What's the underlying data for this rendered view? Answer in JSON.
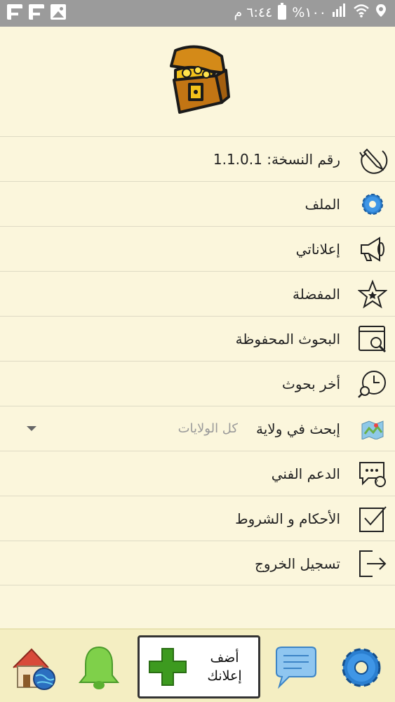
{
  "status_bar": {
    "time": "٦:٤٤ م",
    "battery": "%١٠٠",
    "icons": [
      "flipboard-icon",
      "flipboard-icon",
      "image-icon",
      "battery-icon",
      "signal-icon",
      "wifi-icon",
      "location-icon"
    ]
  },
  "header": {
    "logo_icon": "treasure-chest-icon"
  },
  "menu": {
    "version_label": "رقم النسخة:",
    "version_value": "1.1.0.1",
    "profile": "الملف",
    "my_ads": "إعلاناتي",
    "favorites": "المفضلة",
    "saved_searches": "البحوث المحفوظة",
    "recent_searches": "أخر بحوث",
    "search_state": "إبحث في ولاية",
    "state_selected": "كل الولايات",
    "support": "الدعم الفني",
    "terms": "الأحكام و الشروط",
    "logout": "تسجيل الخروج"
  },
  "bottom_bar": {
    "add_ad_line1": "أضف",
    "add_ad_line2": "إعلانك",
    "items": [
      "settings-icon",
      "messages-icon",
      "add-icon",
      "notifications-bell-icon",
      "home-globe-icon"
    ]
  },
  "colors": {
    "background": "#fbf6dc",
    "bottom_bar": "#f4eec2",
    "status_bar": "#9b9b9b",
    "accent_green": "#3d9a1f",
    "accent_blue": "#2b7fd0"
  }
}
